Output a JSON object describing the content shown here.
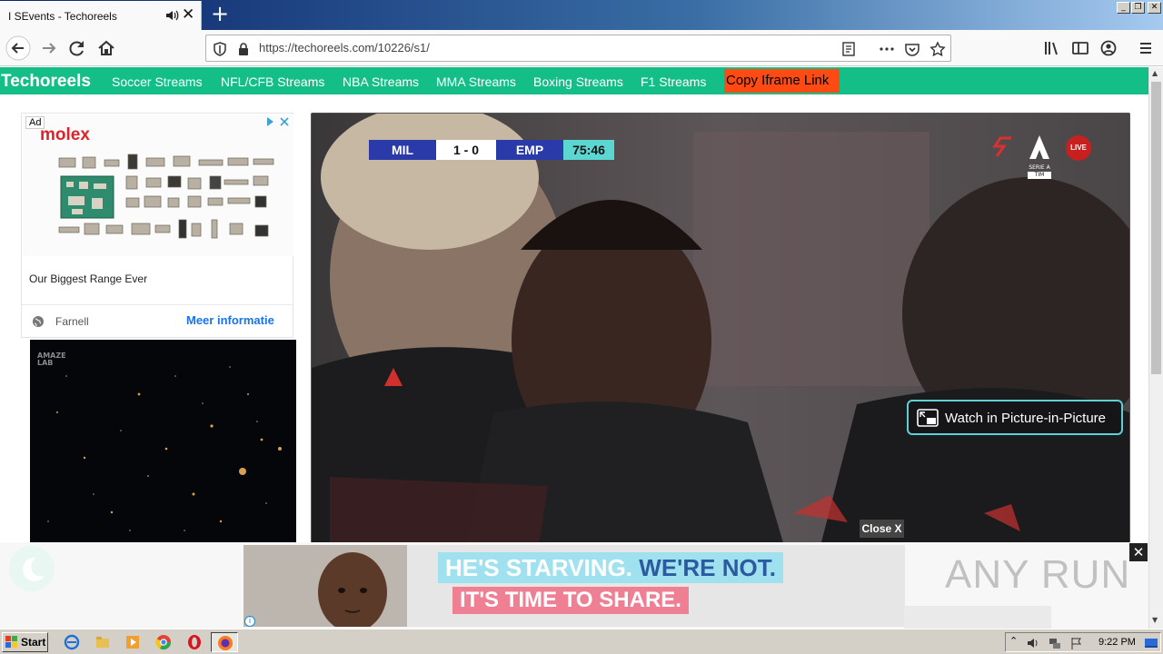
{
  "browser": {
    "tab_title": "I SEvents - Techoreels",
    "url": "https://techoreels.com/10226/s1/"
  },
  "site": {
    "brand": "Techoreels",
    "nav": [
      {
        "label": "Soccer Streams"
      },
      {
        "label": "NFL/CFB Streams"
      },
      {
        "label": "NBA Streams"
      },
      {
        "label": "MMA Streams"
      },
      {
        "label": "Boxing Streams"
      },
      {
        "label": "F1 Streams"
      }
    ],
    "copy_iframe_label": "Copy Iframe Link"
  },
  "ad": {
    "badge": "Ad",
    "brand_logo": "molex",
    "headline": "Our Biggest Range Ever",
    "advertiser": "Farnell",
    "cta": "Meer informatie"
  },
  "space_ad": {
    "logo_line1": "AMAZE",
    "logo_line2": "LAB"
  },
  "video": {
    "home_team": "MIL",
    "score": "1 - 0",
    "away_team": "EMP",
    "clock": "75:46",
    "live_badge": "LIVE",
    "league_badge_line1": "SERIE A",
    "league_badge_line2": "TIM",
    "pip_label": "Watch in Picture-in-Picture"
  },
  "overlay": {
    "close_label": "Close X",
    "banner_line1": "HE'S STARVING.",
    "banner_line1b": "WE'RE NOT.",
    "banner_line2": "IT'S TIME TO SHARE.",
    "banner_close": "✕",
    "watermark": "ANY RUN"
  },
  "taskbar": {
    "start_label": "Start",
    "clock": "9:22 PM"
  },
  "colors": {
    "site_green": "#14bf87",
    "copy_link_bg": "#ff4a14",
    "pip_border": "#5ed0d8"
  }
}
